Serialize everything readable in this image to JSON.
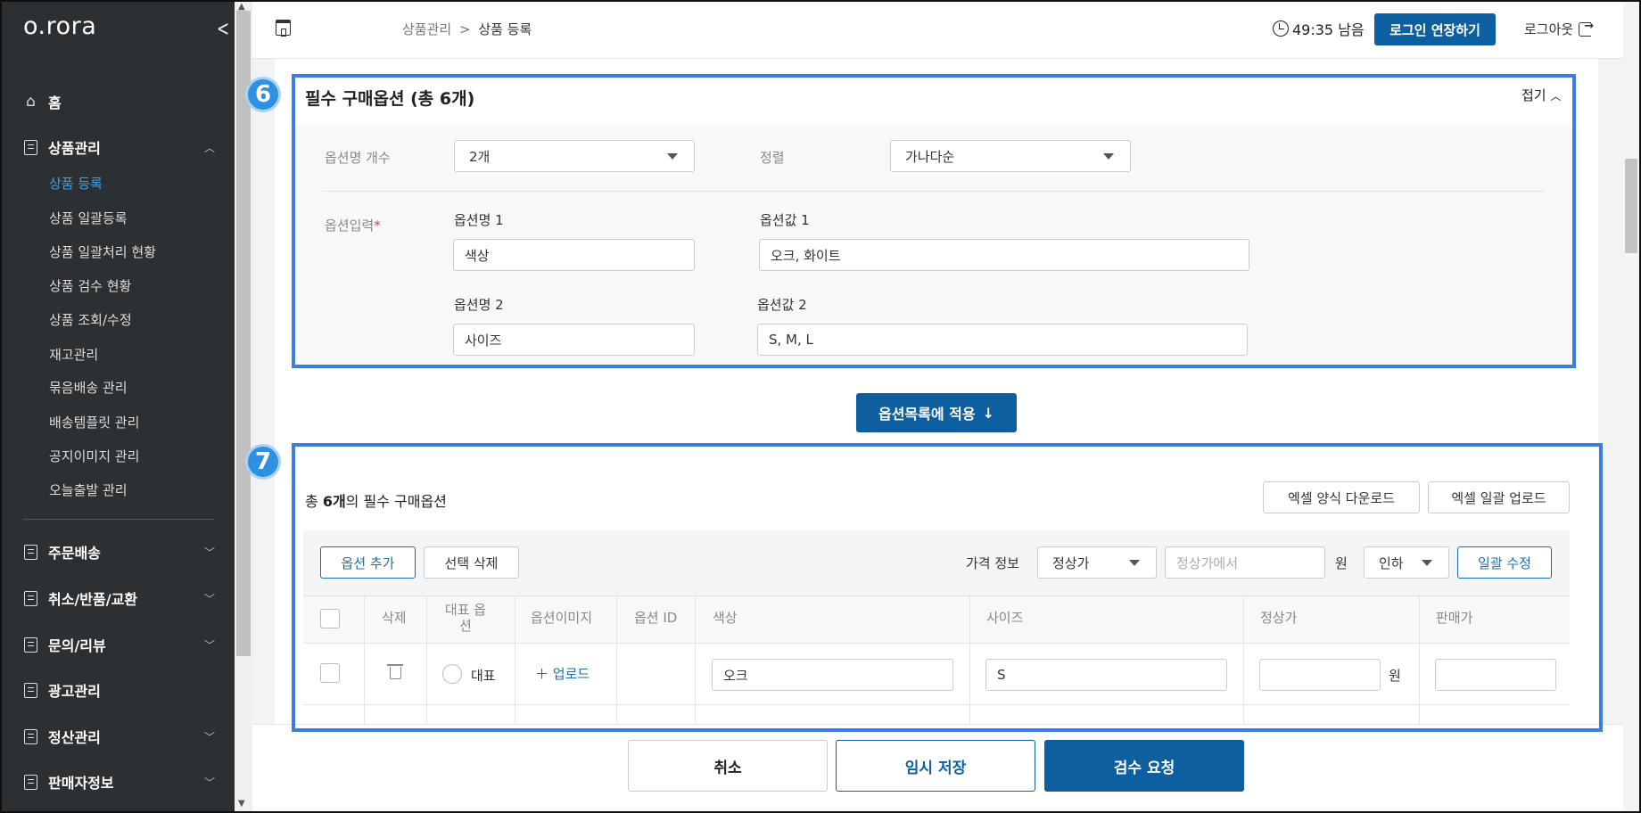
{
  "sidebar": {
    "logo": "o.rora",
    "home": "홈",
    "product_mgmt": "상품관리",
    "sub_items": [
      "상품 등록",
      "상품 일괄등록",
      "상품 일괄처리 현황",
      "상품 검수 현황",
      "상품 조회/수정",
      "재고관리",
      "묶음배송 관리",
      "배송템플릿 관리",
      "공지이미지 관리",
      "오늘출발 관리"
    ],
    "bottom_items": [
      "주문배송",
      "취소/반품/교환",
      "문의/리뷰",
      "광고관리",
      "정산관리",
      "판매자정보"
    ]
  },
  "header": {
    "breadcrumb_parent": "상품관리",
    "breadcrumb_sep": ">",
    "breadcrumb_current": "상품 등록",
    "timer": "49:35 남음",
    "extend_button": "로그인 연장하기",
    "logout": "로그아웃"
  },
  "section6": {
    "badge": "6",
    "title": "필수 구매옵션 (총 6개)",
    "fold": "접기",
    "count_label": "옵션명 개수",
    "count_value": "2개",
    "sort_label": "정렬",
    "sort_value": "가나다순",
    "input_label": "옵션입력",
    "required_mark": "*",
    "options": [
      {
        "name_label": "옵션명 1",
        "name_value": "색상",
        "value_label": "옵션값 1",
        "value_value": "오크, 화이트"
      },
      {
        "name_label": "옵션명 2",
        "name_value": "사이즈",
        "value_label": "옵션값 2",
        "value_value": "S, M, L"
      }
    ]
  },
  "apply_button": "옵션목록에 적용",
  "section7": {
    "badge": "7",
    "total_prefix": "총 ",
    "total_count": "6개",
    "total_suffix": "의 필수 구매옵션",
    "excel_download": "엑셀 양식 다운로드",
    "excel_upload": "엑셀 일괄 업로드",
    "add_option": "옵션 추가",
    "delete_selected": "선택 삭제",
    "price_info_label": "가격 정보",
    "price_type": "정상가",
    "price_placeholder": "정상가에서",
    "won": "원",
    "direction": "인하",
    "bulk_edit": "일괄 수정",
    "columns": [
      "삭제",
      "대표 옵션",
      "옵션이미지",
      "옵션 ID",
      "색상",
      "사이즈",
      "정상가",
      "판매가"
    ],
    "row": {
      "rep": "대표",
      "upload": "업로드",
      "color": "오크",
      "size": "S",
      "won": "원"
    }
  },
  "bottom": {
    "cancel": "취소",
    "temp_save": "임시 저장",
    "review_request": "검수 요청"
  }
}
